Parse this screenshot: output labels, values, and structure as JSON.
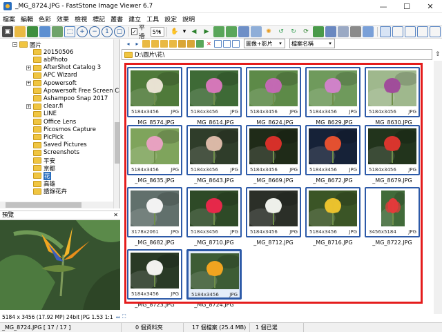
{
  "window": {
    "title": "_MG_8724.JPG  -  FastStone Image Viewer 6.7",
    "minimize": "—",
    "maximize": "☐",
    "close": "✕"
  },
  "menu": [
    "檔案",
    "編輯",
    "色彩",
    "效果",
    "檢視",
    "標記",
    "叢書",
    "建立",
    "工具",
    "設定",
    "說明"
  ],
  "toolbar": {
    "smooth_label": "平滑",
    "smooth_checked": "✓",
    "zoom_value": "5%"
  },
  "nav": {
    "filter_value": "圖像+影片",
    "sort_value": "檔案名稱"
  },
  "address": {
    "path": "D:\\圖片\\花\\"
  },
  "tree": {
    "items": [
      {
        "label": "圖片",
        "indent": 1,
        "expander": "−"
      },
      {
        "label": "20150506",
        "indent": 2
      },
      {
        "label": "abPhoto",
        "indent": 2
      },
      {
        "label": "AfterShot Catalog 3",
        "indent": 2,
        "expander": "+"
      },
      {
        "label": "APC Wizard",
        "indent": 2
      },
      {
        "label": "Apowersoft",
        "indent": 2,
        "expander": "+"
      },
      {
        "label": "Apowersoft Free Screen Capt",
        "indent": 2
      },
      {
        "label": "Ashampoo Snap 2017",
        "indent": 2
      },
      {
        "label": "clear.fi",
        "indent": 2,
        "expander": "+"
      },
      {
        "label": "LINE",
        "indent": 2
      },
      {
        "label": "Office Lens",
        "indent": 2
      },
      {
        "label": "Picosmos Capture",
        "indent": 2
      },
      {
        "label": "PicPick",
        "indent": 2
      },
      {
        "label": "Saved Pictures",
        "indent": 2
      },
      {
        "label": "Screenshots",
        "indent": 2
      },
      {
        "label": "平安",
        "indent": 2
      },
      {
        "label": "京都",
        "indent": 2
      },
      {
        "label": "花",
        "indent": 2,
        "selected": true
      },
      {
        "label": "高雄",
        "indent": 2
      },
      {
        "label": "語錄花卉",
        "indent": 2
      }
    ]
  },
  "preview": {
    "title": "預覽",
    "close": "✕",
    "info": "5184 x 3456 (17.92 MP)  24bit  JPG   1.53  1:1"
  },
  "thumbnails": [
    {
      "name": "_MG_8574.JPG",
      "dim": "5184x3456",
      "fmt": "JPG",
      "bg": "#4f7a3a",
      "accent": "#e8e1d2"
    },
    {
      "name": "_MG_8614.JPG",
      "dim": "5184x3456",
      "fmt": "JPG",
      "bg": "#3e6a36",
      "accent": "#d477b8"
    },
    {
      "name": "_MG_8624.JPG",
      "dim": "5184x3456",
      "fmt": "JPG",
      "bg": "#5d8a48",
      "accent": "#c36ab3"
    },
    {
      "name": "_MG_8629.JPG",
      "dim": "5184x3456",
      "fmt": "JPG",
      "bg": "#6f9a5c",
      "accent": "#cf82c8"
    },
    {
      "name": "_MG_8630.JPG",
      "dim": "5184x3456",
      "fmt": "JPG",
      "bg": "#9fb88d",
      "accent": "#a04d9a"
    },
    {
      "name": "_MG_8635.JPG",
      "dim": "5184x3456",
      "fmt": "JPG",
      "bg": "#7fa45c",
      "accent": "#e7a1c0"
    },
    {
      "name": "_MG_8643.JPG",
      "dim": "5184x3456",
      "fmt": "JPG",
      "bg": "#2f3d2a",
      "accent": "#d9b8a6"
    },
    {
      "name": "_MG_8669.JPG",
      "dim": "5184x3456",
      "fmt": "JPG",
      "bg": "#1f2b18",
      "accent": "#d5302a"
    },
    {
      "name": "_MG_8672.JPG",
      "dim": "5184x3456",
      "fmt": "JPG",
      "bg": "#162238",
      "accent": "#e35030"
    },
    {
      "name": "_MG_8679.JPG",
      "dim": "5184x3456",
      "fmt": "JPG",
      "bg": "#22341c",
      "accent": "#d8352e"
    },
    {
      "name": "_MG_8682.JPG",
      "dim": "3178x2061",
      "fmt": "JPG",
      "bg": "#61706c",
      "accent": "#f2f2f2"
    },
    {
      "name": "_MG_8710.JPG",
      "dim": "5184x3456",
      "fmt": "JPG",
      "bg": "#2e4a27",
      "accent": "#e5284a"
    },
    {
      "name": "_MG_8712.JPG",
      "dim": "5184x3456",
      "fmt": "JPG",
      "bg": "#2b2f28",
      "accent": "#eef0ea"
    },
    {
      "name": "_MG_8716.JPG",
      "dim": "5184x3456",
      "fmt": "JPG",
      "bg": "#3b5526",
      "accent": "#e9c12e"
    },
    {
      "name": "_MG_8722.JPG",
      "dim": "3456x5184",
      "fmt": "JPG",
      "bg": "#416b3a",
      "accent": "#e23b3b",
      "portrait": true
    },
    {
      "name": "_MG_8723.JPG",
      "dim": "5184x3456",
      "fmt": "JPG",
      "bg": "#2a3a26",
      "accent": "#f1f1ee"
    },
    {
      "name": "_MG_8724.JPG",
      "dim": "5184x3456",
      "fmt": "JPG",
      "bg": "#3d5c35",
      "accent": "#f0a420",
      "selected": true
    }
  ],
  "status": {
    "file": "_MG_8724.JPG [ 17 / 17 ]",
    "folders": "0 個資料夾",
    "files": "17 個檔案 (25.4 MB)",
    "selected": "1 個已選"
  }
}
